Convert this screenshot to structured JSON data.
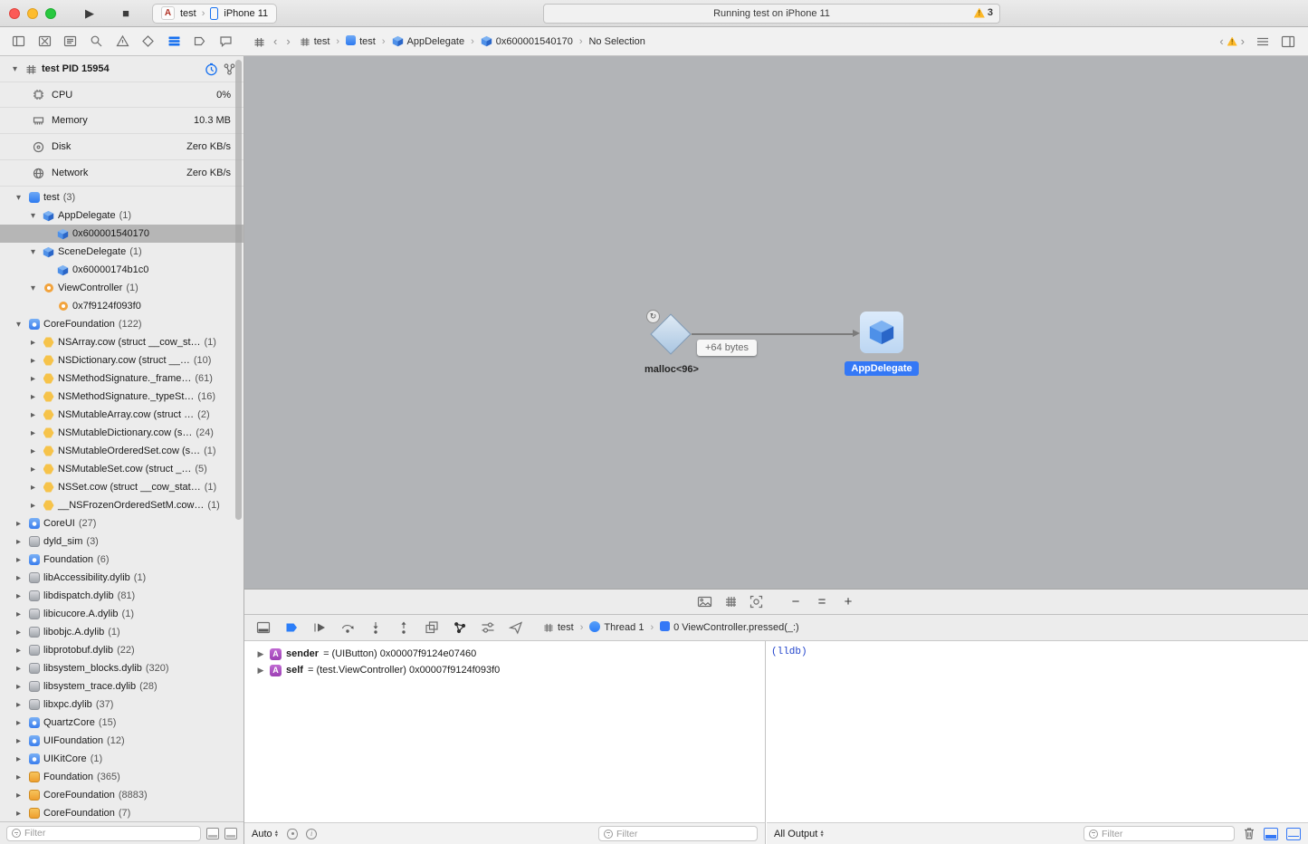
{
  "colors": {
    "accent_blue": "#2d7af0",
    "node_label_blue": "#3478f6",
    "selection_gray": "#b6b6b6",
    "canvas_bg": "#b2b4b7",
    "warning_yellow": "#fdb827",
    "hexagon_yellow": "#f6c34a",
    "badge_purple": "#a74fbb",
    "lldb_blue": "#2244cc"
  },
  "titlebar": {
    "run_glyph": "▶",
    "stop_glyph": "■",
    "scheme_app": "test",
    "scheme_device": "iPhone 11",
    "status_text": "Running test on iPhone 11",
    "warning_count": "3"
  },
  "navigator_tabs": [
    "project",
    "source-control",
    "symbols",
    "find",
    "issues",
    "tests",
    "debug",
    "breakpoints",
    "reports"
  ],
  "navigator_selected": "debug",
  "jumpbar": {
    "crumbs": [
      {
        "label": "test",
        "icon": "grid"
      },
      {
        "label": "test",
        "icon": "app"
      },
      {
        "label": "AppDelegate",
        "icon": "cube"
      },
      {
        "label": "0x600001540170",
        "icon": "cube"
      },
      {
        "label": "No Selection",
        "icon": "none"
      }
    ]
  },
  "sidebar": {
    "process_label": "test PID 15954",
    "gauges": [
      {
        "label": "CPU",
        "value": "0%",
        "icon": "cpu"
      },
      {
        "label": "Memory",
        "value": "10.3 MB",
        "icon": "memory"
      },
      {
        "label": "Disk",
        "value": "Zero KB/s",
        "icon": "disk"
      },
      {
        "label": "Network",
        "value": "Zero KB/s",
        "icon": "network"
      }
    ],
    "tree": [
      {
        "label": "test",
        "count": "(3)",
        "level": 0,
        "disclosure": "open",
        "icon": "target"
      },
      {
        "label": "AppDelegate",
        "count": "(1)",
        "level": 1,
        "disclosure": "open",
        "icon": "cube"
      },
      {
        "label": "0x600001540170",
        "count": "",
        "level": 2,
        "disclosure": "none",
        "icon": "cube",
        "selected": true
      },
      {
        "label": "SceneDelegate",
        "count": "(1)",
        "level": 1,
        "disclosure": "open",
        "icon": "cube"
      },
      {
        "label": "0x60000174b1c0",
        "count": "",
        "level": 2,
        "disclosure": "none",
        "icon": "cube"
      },
      {
        "label": "ViewController",
        "count": "(1)",
        "level": 1,
        "disclosure": "open",
        "icon": "ring"
      },
      {
        "label": "0x7f9124f093f0",
        "count": "",
        "level": 2,
        "disclosure": "none",
        "icon": "ring"
      },
      {
        "label": "CoreFoundation",
        "count": "(122)",
        "level": 0,
        "disclosure": "open",
        "icon": "framework"
      },
      {
        "label": "NSArray.cow (struct __cow_st…",
        "count": "(1)",
        "level": 1,
        "disclosure": "closed",
        "icon": "hexagon"
      },
      {
        "label": "NSDictionary.cow (struct __…",
        "count": "(10)",
        "level": 1,
        "disclosure": "closed",
        "icon": "hexagon"
      },
      {
        "label": "NSMethodSignature._frame…",
        "count": "(61)",
        "level": 1,
        "disclosure": "closed",
        "icon": "hexagon"
      },
      {
        "label": "NSMethodSignature._typeSt…",
        "count": "(16)",
        "level": 1,
        "disclosure": "closed",
        "icon": "hexagon"
      },
      {
        "label": "NSMutableArray.cow (struct …",
        "count": "(2)",
        "level": 1,
        "disclosure": "closed",
        "icon": "hexagon"
      },
      {
        "label": "NSMutableDictionary.cow (s…",
        "count": "(24)",
        "level": 1,
        "disclosure": "closed",
        "icon": "hexagon"
      },
      {
        "label": "NSMutableOrderedSet.cow (s…",
        "count": "(1)",
        "level": 1,
        "disclosure": "closed",
        "icon": "hexagon"
      },
      {
        "label": "NSMutableSet.cow (struct _…",
        "count": "(5)",
        "level": 1,
        "disclosure": "closed",
        "icon": "hexagon"
      },
      {
        "label": "NSSet.cow (struct __cow_stat…",
        "count": "(1)",
        "level": 1,
        "disclosure": "closed",
        "icon": "hexagon"
      },
      {
        "label": "__NSFrozenOrderedSetM.cow…",
        "count": "(1)",
        "level": 1,
        "disclosure": "closed",
        "icon": "hexagon"
      },
      {
        "label": "CoreUI",
        "count": "(27)",
        "level": 0,
        "disclosure": "closed",
        "icon": "framework"
      },
      {
        "label": "dyld_sim",
        "count": "(3)",
        "level": 0,
        "disclosure": "closed",
        "icon": "dylib"
      },
      {
        "label": "Foundation",
        "count": "(6)",
        "level": 0,
        "disclosure": "closed",
        "icon": "framework"
      },
      {
        "label": "libAccessibility.dylib",
        "count": "(1)",
        "level": 0,
        "disclosure": "closed",
        "icon": "dylib"
      },
      {
        "label": "libdispatch.dylib",
        "count": "(81)",
        "level": 0,
        "disclosure": "closed",
        "icon": "dylib"
      },
      {
        "label": "libicucore.A.dylib",
        "count": "(1)",
        "level": 0,
        "disclosure": "closed",
        "icon": "dylib"
      },
      {
        "label": "libobjc.A.dylib",
        "count": "(1)",
        "level": 0,
        "disclosure": "closed",
        "icon": "dylib"
      },
      {
        "label": "libprotobuf.dylib",
        "count": "(22)",
        "level": 0,
        "disclosure": "closed",
        "icon": "dylib"
      },
      {
        "label": "libsystem_blocks.dylib",
        "count": "(320)",
        "level": 0,
        "disclosure": "closed",
        "icon": "dylib"
      },
      {
        "label": "libsystem_trace.dylib",
        "count": "(28)",
        "level": 0,
        "disclosure": "closed",
        "icon": "dylib"
      },
      {
        "label": "libxpc.dylib",
        "count": "(37)",
        "level": 0,
        "disclosure": "closed",
        "icon": "dylib"
      },
      {
        "label": "QuartzCore",
        "count": "(15)",
        "level": 0,
        "disclosure": "closed",
        "icon": "framework"
      },
      {
        "label": "UIFoundation",
        "count": "(12)",
        "level": 0,
        "disclosure": "closed",
        "icon": "framework"
      },
      {
        "label": "UIKitCore",
        "count": "(1)",
        "level": 0,
        "disclosure": "closed",
        "icon": "framework"
      },
      {
        "label": "Foundation",
        "count": "(365)",
        "level": 0,
        "disclosure": "closed",
        "icon": "table"
      },
      {
        "label": "CoreFoundation",
        "count": "(8883)",
        "level": 0,
        "disclosure": "closed",
        "icon": "table"
      },
      {
        "label": "CoreFoundation",
        "count": "(7)",
        "level": 0,
        "disclosure": "closed",
        "icon": "table"
      }
    ],
    "filter_placeholder": "Filter"
  },
  "canvas": {
    "malloc_label": "malloc<96>",
    "edge_label": "+64 bytes",
    "appdelegate_label": "AppDelegate",
    "toolbar_icons": [
      "snapshot",
      "grid",
      "focus"
    ],
    "zoom_out": "−",
    "zoom_reset": "=",
    "zoom_in": "+"
  },
  "debugbar": {
    "icons": [
      "hide-debug-area",
      "breakpoints-toggle",
      "continue",
      "step-over",
      "step-into",
      "step-out",
      "view-hierarchy",
      "memory-graph",
      "environment-overrides",
      "simulate-location"
    ],
    "crumbs": [
      {
        "label": "test",
        "icon": "grid"
      },
      {
        "label": "Thread 1",
        "icon": "thread"
      },
      {
        "label": "0 ViewController.pressed(_:)",
        "icon": "frame"
      }
    ]
  },
  "variables": {
    "badge": "A",
    "rows": [
      {
        "name": "sender",
        "value": "= (UIButton) 0x00007f9124e07460"
      },
      {
        "name": "self",
        "value": "= (test.ViewController) 0x00007f9124f093f0"
      }
    ],
    "scope_label": "Auto",
    "filter_placeholder": "Filter"
  },
  "console": {
    "prompt": "(lldb)",
    "scope_label": "All Output",
    "filter_placeholder": "Filter"
  }
}
